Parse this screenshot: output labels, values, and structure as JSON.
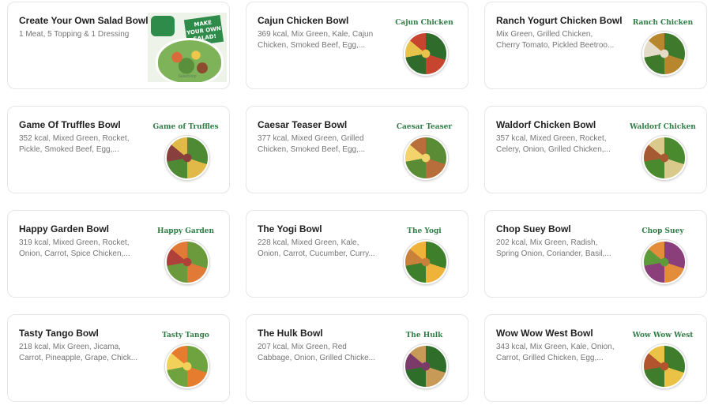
{
  "menu": {
    "items": [
      {
        "title": "Create Your Own Salad Bowl",
        "desc": "1 Meat, 5 Topping & 1 Dressing",
        "thumb_label": "",
        "promo": {
          "tag_text": "MAKE YOUR OWN SALAD!",
          "brand_text": "SaladStop"
        },
        "bowl_colors": [
          "#7fb35a",
          "#d96b3a",
          "#f0c64a"
        ]
      },
      {
        "title": "Cajun Chicken Bowl",
        "desc": "369 kcal, Mix Green, Kale, Cajun Chicken, Smoked Beef, Egg,...",
        "thumb_label": "Cajun Chicken",
        "bowl_colors": [
          "#2f6b2a",
          "#c7452f",
          "#e7c34b"
        ]
      },
      {
        "title": "Ranch Yogurt Chicken Bowl",
        "desc": "Mix Green, Grilled Chicken, Cherry Tomato, Pickled Beetroo...",
        "thumb_label": "Ranch Chicken",
        "bowl_colors": [
          "#3f7a2c",
          "#b8862d",
          "#e4dcc8"
        ]
      },
      {
        "title": "Game Of Truffles Bowl",
        "desc": "352 kcal, Mixed Green, Rocket, Pickle, Smoked Beef, Egg,...",
        "thumb_label": "Game of Truffles",
        "bowl_colors": [
          "#4e8a33",
          "#e1b949",
          "#8a3f3f"
        ]
      },
      {
        "title": "Caesar Teaser Bowl",
        "desc": "377 kcal, Mixed Green, Grilled Chicken, Smoked Beef, Egg,...",
        "thumb_label": "Caesar Teaser",
        "bowl_colors": [
          "#5a8c36",
          "#b86e3a",
          "#f2d36c"
        ]
      },
      {
        "title": "Waldorf Chicken Bowl",
        "desc": "357 kcal, Mixed Green, Rocket, Celery, Onion, Grilled Chicken,...",
        "thumb_label": "Waldorf Chicken",
        "bowl_colors": [
          "#4a8a2e",
          "#d9c98a",
          "#a65a32"
        ]
      },
      {
        "title": "Happy Garden Bowl",
        "desc": "319 kcal, Mixed Green, Rocket, Onion, Carrot, Spice Chicken,...",
        "thumb_label": "Happy Garden",
        "bowl_colors": [
          "#6b9a3c",
          "#e07a36",
          "#b0413a"
        ]
      },
      {
        "title": "The Yogi Bowl",
        "desc": "228 kcal, Mixed Green, Kale, Onion, Carrot, Cucumber, Curry...",
        "thumb_label": "The Yogi",
        "bowl_colors": [
          "#3e7f2b",
          "#f0b33a",
          "#c9803a"
        ]
      },
      {
        "title": "Chop Suey Bowl",
        "desc": "202 kcal, Mix Green, Radish, Spring Onion, Coriander, Basil,...",
        "thumb_label": "Chop Suey",
        "bowl_colors": [
          "#8a3e7a",
          "#e38c3a",
          "#5d9a3a"
        ]
      },
      {
        "title": "Tasty Tango Bowl",
        "desc": "218 kcal, Mix Green, Jicama, Carrot, Pineapple, Grape, Chick...",
        "thumb_label": "Tasty Tango",
        "bowl_colors": [
          "#6fa33f",
          "#e67d2e",
          "#f2d15a"
        ]
      },
      {
        "title": "The Hulk Bowl",
        "desc": "207 kcal, Mix Green, Red Cabbage, Onion, Grilled Chicke...",
        "thumb_label": "The Hulk",
        "bowl_colors": [
          "#2f6e2a",
          "#c79a57",
          "#7c3a6b"
        ]
      },
      {
        "title": "Wow Wow West Bowl",
        "desc": "343 kcal, Mix Green, Kale, Onion, Carrot, Grilled Chicken, Egg,...",
        "thumb_label": "Wow Wow West",
        "bowl_colors": [
          "#3f7d2c",
          "#e9c246",
          "#b2552f"
        ]
      }
    ]
  }
}
